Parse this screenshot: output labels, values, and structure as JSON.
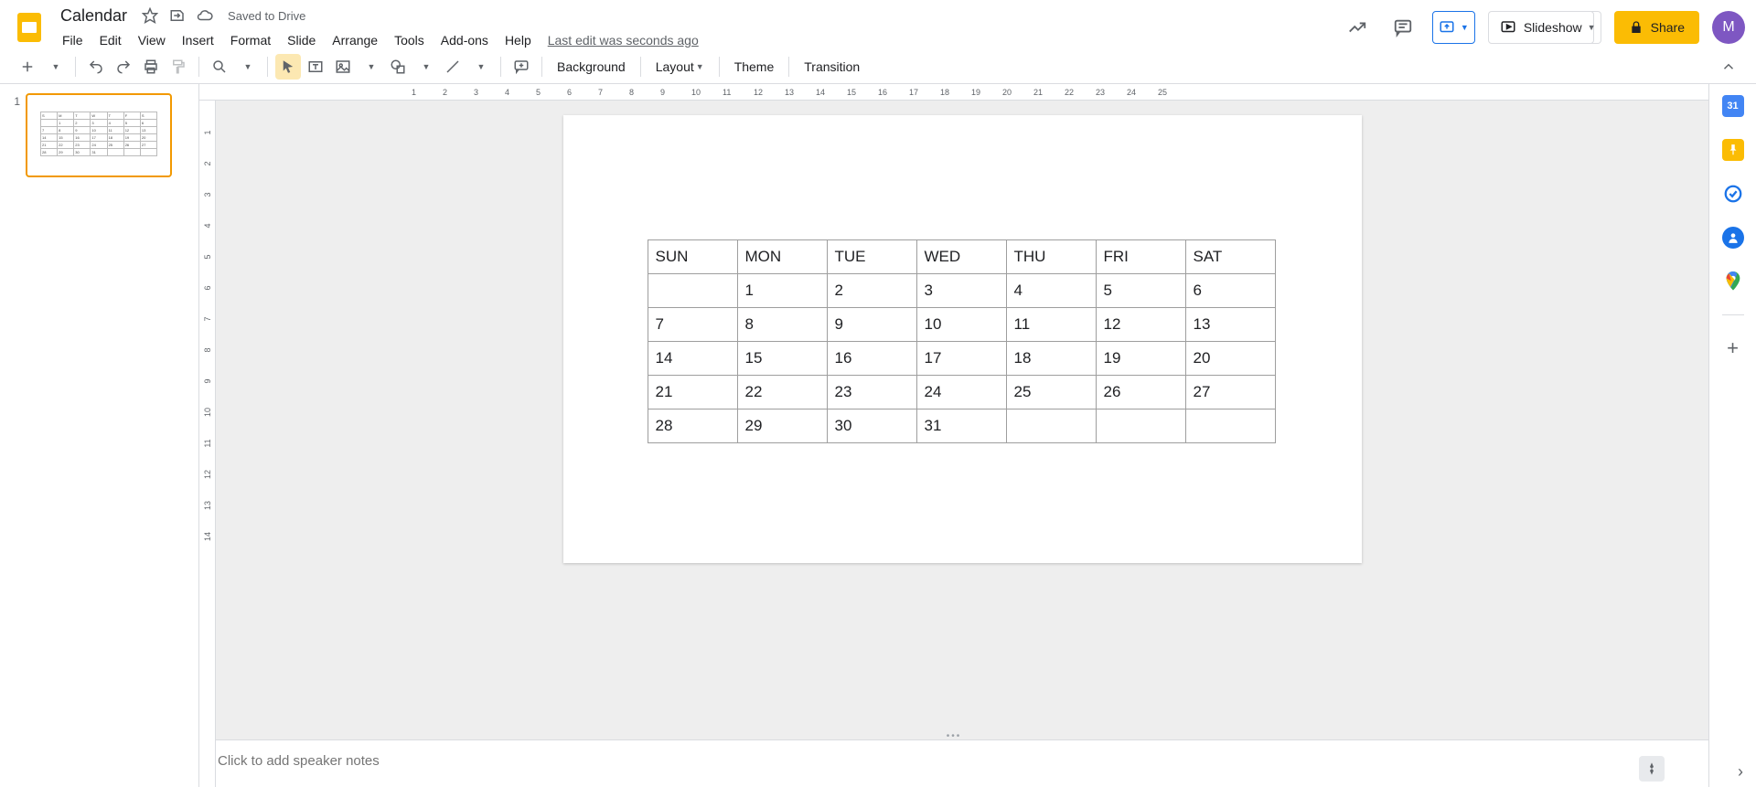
{
  "header": {
    "doc_title": "Calendar",
    "save_status": "Saved to Drive",
    "last_edit": "Last edit was seconds ago",
    "avatar_letter": "M"
  },
  "menubar": [
    "File",
    "Edit",
    "View",
    "Insert",
    "Format",
    "Slide",
    "Arrange",
    "Tools",
    "Add-ons",
    "Help"
  ],
  "title_actions": {
    "slideshow": "Slideshow",
    "share": "Share"
  },
  "toolbar": {
    "background": "Background",
    "layout": "Layout",
    "theme": "Theme",
    "transition": "Transition"
  },
  "filmstrip": {
    "slide1_num": "1"
  },
  "calendar": {
    "headers": [
      "SUN",
      "MON",
      "TUE",
      "WED",
      "THU",
      "FRI",
      "SAT"
    ],
    "rows": [
      [
        "",
        "1",
        "2",
        "3",
        "4",
        "5",
        "6"
      ],
      [
        "7",
        "8",
        "9",
        "10",
        "11",
        "12",
        "13"
      ],
      [
        "14",
        "15",
        "16",
        "17",
        "18",
        "19",
        "20"
      ],
      [
        "21",
        "22",
        "23",
        "24",
        "25",
        "26",
        "27"
      ],
      [
        "28",
        "29",
        "30",
        "31",
        "",
        "",
        ""
      ]
    ]
  },
  "notes_placeholder": "Click to add speaker notes",
  "ruler_h": [
    "1",
    "2",
    "3",
    "4",
    "5",
    "6",
    "7",
    "8",
    "9",
    "10",
    "11",
    "12",
    "13",
    "14",
    "15",
    "16",
    "17",
    "18",
    "19",
    "20",
    "21",
    "22",
    "23",
    "24",
    "25"
  ],
  "ruler_v": [
    "1",
    "2",
    "3",
    "4",
    "5",
    "6",
    "7",
    "8",
    "9",
    "10",
    "11",
    "12",
    "13",
    "14"
  ],
  "chart_data": {
    "type": "table",
    "title": "Calendar",
    "columns": [
      "SUN",
      "MON",
      "TUE",
      "WED",
      "THU",
      "FRI",
      "SAT"
    ],
    "rows": [
      [
        "",
        "1",
        "2",
        "3",
        "4",
        "5",
        "6"
      ],
      [
        "7",
        "8",
        "9",
        "10",
        "11",
        "12",
        "13"
      ],
      [
        "14",
        "15",
        "16",
        "17",
        "18",
        "19",
        "20"
      ],
      [
        "21",
        "22",
        "23",
        "24",
        "25",
        "26",
        "27"
      ],
      [
        "28",
        "29",
        "30",
        "31",
        "",
        "",
        ""
      ]
    ]
  }
}
